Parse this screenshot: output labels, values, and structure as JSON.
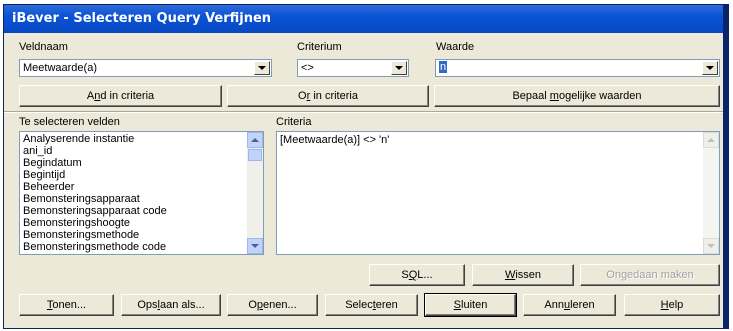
{
  "window": {
    "title": "iBever - Selecteren Query Verfijnen"
  },
  "fields": {
    "veldnaam_label": "Veldnaam",
    "veldnaam_value": "Meetwaarde(a)",
    "criterium_label": "Criterium",
    "criterium_value": "<>",
    "waarde_label": "Waarde",
    "waarde_value": "n"
  },
  "buttons_top": {
    "and_pre": "A",
    "and_ul": "n",
    "and_post": "d in criteria",
    "or_pre": "O",
    "or_ul": "r",
    "or_post": " in criteria",
    "bepaal_pre": "Bepaal ",
    "bepaal_ul": "m",
    "bepaal_post": "ogelijke waarden"
  },
  "te_selecteren": {
    "label": "Te selecteren velden",
    "items": [
      "Analyserende instantie",
      "ani_id",
      "Begindatum",
      "Begintijd",
      "Beheerder",
      "Bemonsteringsapparaat",
      "Bemonsteringsapparaat code",
      "Bemonsteringshoogte",
      "Bemonsteringsmethode",
      "Bemonsteringsmethode code"
    ]
  },
  "criteria": {
    "label": "Criteria",
    "text": "[Meetwaarde(a)] <> 'n'"
  },
  "buttons_mid": {
    "sql_pre": "S",
    "sql_ul": "Q",
    "sql_post": "L...",
    "wissen_ul": "W",
    "wissen_post": "issen",
    "ongedaan": "Ongedaan maken"
  },
  "buttons_bottom": {
    "tonen_ul": "T",
    "tonen_post": "onen...",
    "opslaan_pre": "Ops",
    "opslaan_ul": "l",
    "opslaan_post": "aan als...",
    "openen_pre": "O",
    "openen_ul": "p",
    "openen_post": "enen...",
    "selecteren_pre": "Selec",
    "selecteren_ul": "t",
    "selecteren_post": "eren",
    "sluiten_ul": "S",
    "sluiten_post": "luiten",
    "annuleren_pre": "Ann",
    "annuleren_ul": "u",
    "annuleren_post": "leren",
    "help_ul": "H",
    "help_post": "elp"
  }
}
